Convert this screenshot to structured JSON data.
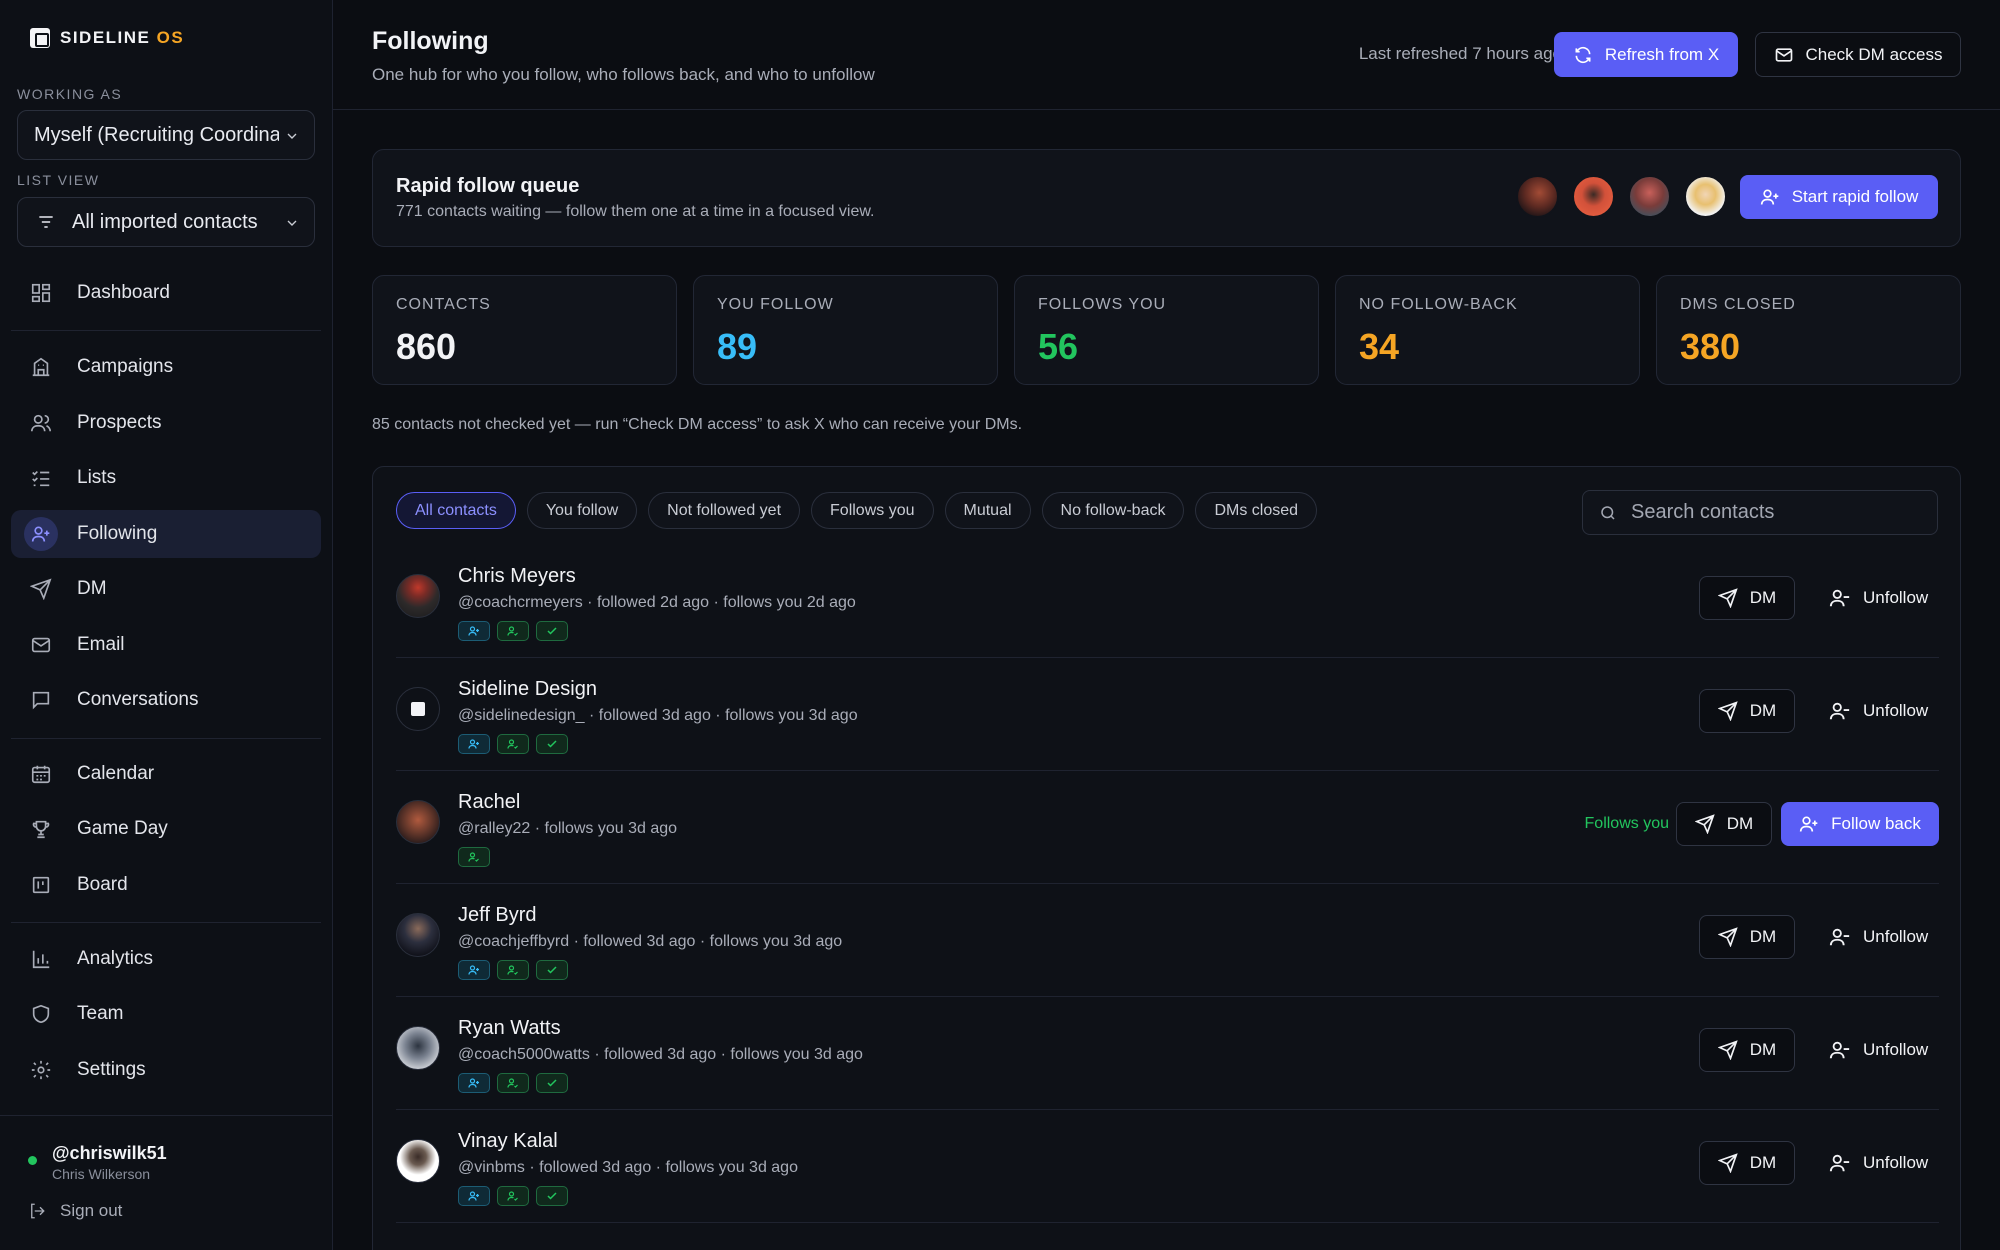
{
  "brand": {
    "name": "SIDELINE",
    "suffix": "OS"
  },
  "sidebar": {
    "working_as_label": "WORKING AS",
    "working_as_value": "Myself (Recruiting Coordinator)",
    "list_view_label": "LIST VIEW",
    "list_view_value": "All imported contacts",
    "items": [
      {
        "label": "Dashboard",
        "icon": "dashboard-icon"
      },
      {
        "label": "Campaigns",
        "icon": "building-icon"
      },
      {
        "label": "Prospects",
        "icon": "users-icon"
      },
      {
        "label": "Lists",
        "icon": "list-check-icon"
      },
      {
        "label": "Following",
        "icon": "user-plus-icon",
        "active": true
      },
      {
        "label": "DM",
        "icon": "send-icon"
      },
      {
        "label": "Email",
        "icon": "mail-icon"
      },
      {
        "label": "Conversations",
        "icon": "chat-icon"
      },
      {
        "label": "Calendar",
        "icon": "calendar-icon"
      },
      {
        "label": "Game Day",
        "icon": "trophy-icon"
      },
      {
        "label": "Board",
        "icon": "board-icon"
      },
      {
        "label": "Analytics",
        "icon": "bar-chart-icon"
      },
      {
        "label": "Team",
        "icon": "shield-icon"
      },
      {
        "label": "Settings",
        "icon": "gear-icon"
      }
    ],
    "user": {
      "handle": "@chriswilk51",
      "name": "Chris Wilkerson",
      "sign_out": "Sign out"
    }
  },
  "header": {
    "title": "Following",
    "subtitle": "One hub for who you follow, who follows back, and who to unfollow",
    "last_refreshed": "Last refreshed 7 hours ago",
    "refresh_label": "Refresh from X",
    "check_dm_label": "Check DM access"
  },
  "queue": {
    "title": "Rapid follow queue",
    "subtitle": "771 contacts waiting — follow them one at a time in a focused view.",
    "start_label": "Start rapid follow"
  },
  "stats": [
    {
      "label": "CONTACTS",
      "value": "860",
      "color": "#f2f3f6"
    },
    {
      "label": "YOU FOLLOW",
      "value": "89",
      "color": "#38bdf8"
    },
    {
      "label": "FOLLOWS YOU",
      "value": "56",
      "color": "#22c55e"
    },
    {
      "label": "NO FOLLOW-BACK",
      "value": "34",
      "color": "#f5a524"
    },
    {
      "label": "DMS CLOSED",
      "value": "380",
      "color": "#f5a524"
    }
  ],
  "note": "85 contacts not checked yet — run “Check DM access” to ask X who can receive your DMs.",
  "filters": [
    "All contacts",
    "You follow",
    "Not followed yet",
    "Follows you",
    "Mutual",
    "No follow-back",
    "DMs closed"
  ],
  "search": {
    "placeholder": "Search contacts"
  },
  "actions": {
    "dm": "DM",
    "unfollow": "Unfollow",
    "follow_back": "Follow back",
    "follows_you": "Follows you"
  },
  "contacts": [
    {
      "name": "Chris Meyers",
      "meta": "@coachcrmeyers · followed 2d ago · follows you 2d ago"
    },
    {
      "name": "Sideline Design",
      "meta": "@sidelinedesign_ · followed 3d ago · follows you 3d ago"
    },
    {
      "name": "Rachel",
      "meta": "@ralley22 · follows you 3d ago"
    },
    {
      "name": "Jeff Byrd",
      "meta": "@coachjeffbyrd · followed 3d ago · follows you 3d ago"
    },
    {
      "name": "Ryan Watts",
      "meta": "@coach5000watts · followed 3d ago · follows you 3d ago"
    },
    {
      "name": "Vinay Kalal",
      "meta": "@vinbms · followed 3d ago · follows you 3d ago"
    }
  ]
}
